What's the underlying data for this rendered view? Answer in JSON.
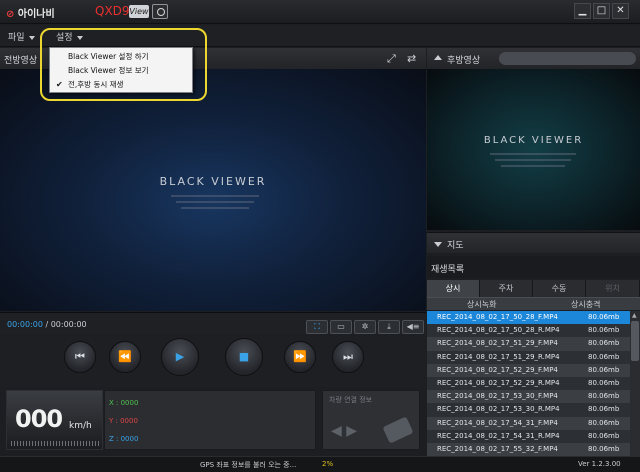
{
  "titlebar": {
    "logo": "아이나비",
    "model": "QXD900",
    "badge": "View",
    "buttons": {
      "minimize": "▁",
      "maximize": "□",
      "close": "✕"
    }
  },
  "menu": {
    "file": "파일",
    "settings": "설정",
    "dropdown": [
      {
        "label": "Black Viewer 설정 하기",
        "checked": false
      },
      {
        "label": "Black Viewer 정보 보기",
        "checked": false
      },
      {
        "label": "전,후방 동시 재생",
        "checked": true
      }
    ],
    "check_glyph": "✔"
  },
  "front": {
    "label": "전방영상",
    "brand": "BLACK VIEWER"
  },
  "rear": {
    "label": "후방영상",
    "brand": "BLACK VIEWER"
  },
  "map": {
    "label": "지도"
  },
  "playlist": {
    "title": "재생목록",
    "tabs": [
      {
        "label": "상시",
        "state": "active"
      },
      {
        "label": "주차",
        "state": "normal"
      },
      {
        "label": "수동",
        "state": "normal"
      },
      {
        "label": "위치",
        "state": "disabled"
      }
    ],
    "columns": [
      "상시녹화",
      "상시충격"
    ],
    "rows": [
      {
        "name": "REC_2014_08_02_17_50_28_F.MP4",
        "size": "80.06mb",
        "selected": true
      },
      {
        "name": "REC_2014_08_02_17_50_28_R.MP4",
        "size": "80.06mb",
        "selected": false
      },
      {
        "name": "REC_2014_08_02_17_51_29_F.MP4",
        "size": "80.06mb",
        "selected": false
      },
      {
        "name": "REC_2014_08_02_17_51_29_R.MP4",
        "size": "80.06mb",
        "selected": false
      },
      {
        "name": "REC_2014_08_02_17_52_29_F.MP4",
        "size": "80.06mb",
        "selected": false
      },
      {
        "name": "REC_2014_08_02_17_52_29_R.MP4",
        "size": "80.06mb",
        "selected": false
      },
      {
        "name": "REC_2014_08_02_17_53_30_F.MP4",
        "size": "80.06mb",
        "selected": false
      },
      {
        "name": "REC_2014_08_02_17_53_30_R.MP4",
        "size": "80.06mb",
        "selected": false
      },
      {
        "name": "REC_2014_08_02_17_54_31_F.MP4",
        "size": "80.06mb",
        "selected": false
      },
      {
        "name": "REC_2014_08_02_17_54_31_R.MP4",
        "size": "80.06mb",
        "selected": false
      },
      {
        "name": "REC_2014_08_02_17_55_32_F.MP4",
        "size": "80.06mb",
        "selected": false
      }
    ]
  },
  "player": {
    "current_time": "00:00:00",
    "separator": " / ",
    "total_time": "00:00:00",
    "buttons": {
      "prev": "⏮",
      "rewind": "⏪",
      "play": "▶",
      "stop": "■",
      "forward": "⏩",
      "next": "⏭"
    }
  },
  "telemetry": {
    "speed": "000",
    "unit": "km/h",
    "x": "X : 0000",
    "y": "Y : 0000",
    "z": "Z : 0000"
  },
  "vehicle": {
    "label": "차량 연결 정보"
  },
  "status": {
    "message": "GPS 좌표 정보를 불러 오는 중...",
    "percent": "2%",
    "version": "Ver 1.2.3.00"
  },
  "colors": {
    "accent": "#1c86d8",
    "highlight": "#ecd731",
    "model": "#e8312f"
  }
}
